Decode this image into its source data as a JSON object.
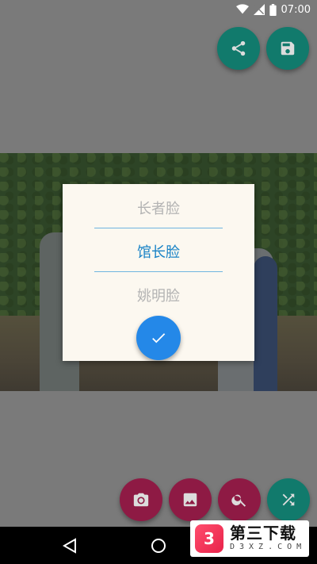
{
  "status_bar": {
    "time": "07:00",
    "icons": [
      "wifi-icon",
      "signal-icon",
      "battery-icon"
    ]
  },
  "top_actions": [
    {
      "name": "share",
      "icon": "share-icon"
    },
    {
      "name": "save",
      "icon": "save-icon"
    }
  ],
  "picker": {
    "items": [
      "长者脸",
      "馆长脸",
      "姚明脸"
    ],
    "selected_index": 1,
    "confirm_icon": "check-icon"
  },
  "bottom_actions": [
    {
      "name": "camera",
      "icon": "camera-icon"
    },
    {
      "name": "gallery",
      "icon": "image-icon"
    },
    {
      "name": "search",
      "icon": "search-icon"
    },
    {
      "name": "shuffle",
      "icon": "shuffle-icon"
    }
  ],
  "navigation": [
    "back-icon",
    "home-icon",
    "recents-icon"
  ],
  "watermark": {
    "logo_glyph": "3",
    "title": "第三下载",
    "subtitle": "D3XZ.COM"
  },
  "colors": {
    "teal_fab": "#117a6c",
    "pink_fab": "#8e1a44",
    "accent": "#1a83c6",
    "confirm": "#2488e8",
    "dialog_bg": "#fcf8f0"
  }
}
